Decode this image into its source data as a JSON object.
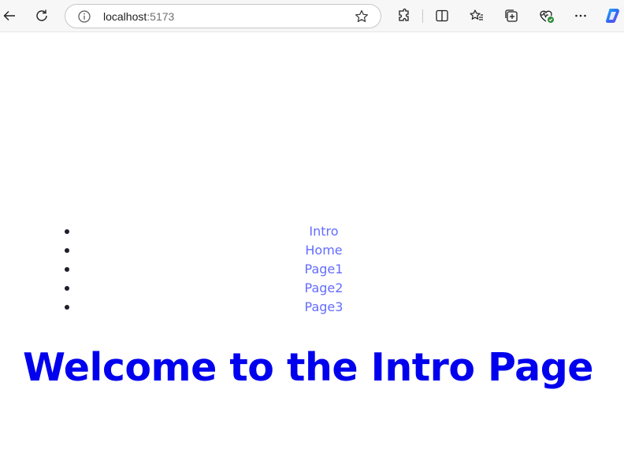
{
  "browser": {
    "url_host": "localhost",
    "url_port": ":5173",
    "toolbar_icons": [
      "back-icon",
      "refresh-icon",
      "info-icon",
      "favorite-star-icon",
      "extensions-icon",
      "split-screen-icon",
      "favorites-icon",
      "collections-icon",
      "browser-essentials-icon",
      "more-icon",
      "copilot-icon"
    ]
  },
  "nav": {
    "items": [
      {
        "label": "Intro"
      },
      {
        "label": "Home"
      },
      {
        "label": "Page1"
      },
      {
        "label": "Page2"
      },
      {
        "label": "Page3"
      }
    ]
  },
  "main": {
    "title": "Welcome to the Intro Page"
  },
  "colors": {
    "link": "#646cff",
    "title": "#0000ee",
    "bullet": "#1e1e2c",
    "toolbar_bg": "#f7f7f7"
  }
}
